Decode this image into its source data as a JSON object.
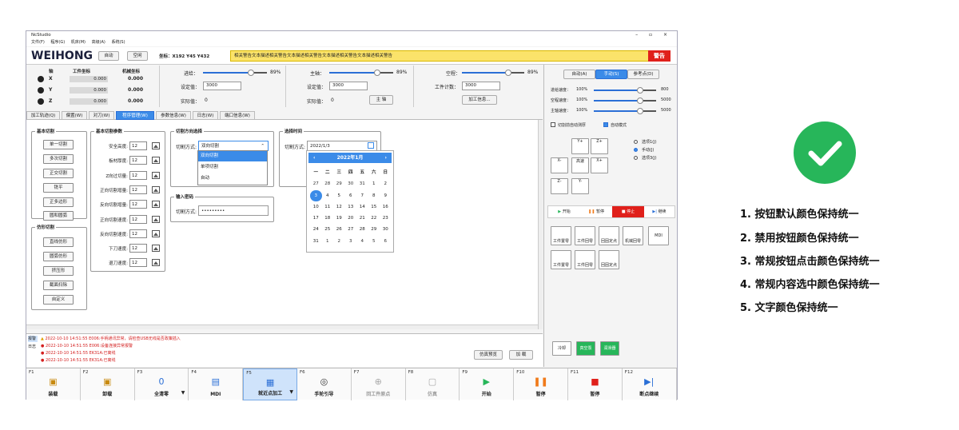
{
  "app": {
    "title": "NcStudio",
    "window_controls": "– ▫ ×",
    "menu": [
      "文件(F)",
      "程序(G)",
      "机床(M)",
      "高级(A)",
      "系统(S)"
    ]
  },
  "toprow": {
    "logo": "WEIHONG",
    "auto_btn": "自动",
    "air_btn": "空闲",
    "coords": "坐标：X192   Y45   Y432",
    "alarm_text": "相关警告文本描述相关警告文本描述相关警告文本描述相关警告文本描述相关警告",
    "alarm_btn": "警告"
  },
  "coordpanel": {
    "h_axis": "轴",
    "h_work": "工件坐标",
    "h_mach": "机械坐标",
    "rows": [
      {
        "axis": "X",
        "work": "0.000",
        "mach": "0.000"
      },
      {
        "axis": "Y",
        "work": "0.000",
        "mach": "0.000"
      },
      {
        "axis": "Z",
        "work": "0.000",
        "mach": "0.000"
      }
    ]
  },
  "feed": {
    "label": "进给：",
    "percent": "89%",
    "set_label": "设定值：",
    "set": "3000",
    "actual_label": "实际值：",
    "actual": "0"
  },
  "spindle": {
    "label": "主轴：",
    "percent": "89%",
    "set_label": "设定值：",
    "set": "3000",
    "actual_label": "实际值：",
    "actual": "0",
    "btn": "主 轴"
  },
  "rapid": {
    "label": "空程：",
    "percent": "89%",
    "count_label": "工件计数：",
    "count": "3000",
    "btn": "加工信息..."
  },
  "tabs": [
    "加工轨迹(Q)",
    "偏置(W)",
    "对刀(W)",
    "程序管理(W)",
    "参数信息(W)",
    "日志(W)",
    "端口信息(W)"
  ],
  "basic_cut": {
    "title": "基本切割",
    "buttons": [
      "单一切割",
      "多次切割",
      "正交切割",
      "铣平",
      "正多边形",
      "圆和圆弧"
    ]
  },
  "shape_cut": {
    "title": "仿形切割",
    "buttons": [
      "直线仿形",
      "圆弧仿形",
      "挤压形",
      "截面扫除",
      "自定义"
    ]
  },
  "params": {
    "title": "基本切割参数",
    "rows": [
      {
        "label": "安全高度:",
        "value": "12"
      },
      {
        "label": "板材厚度:",
        "value": "12"
      },
      {
        "label": "Z向过切量:",
        "value": "12"
      },
      {
        "label": "正向切割增量:",
        "value": "12"
      },
      {
        "label": "反向切割增量:",
        "value": "12"
      },
      {
        "label": "正向切割速度:",
        "value": "12"
      },
      {
        "label": "反向切割速度:",
        "value": "12"
      },
      {
        "label": "下刀速度:",
        "value": "12"
      },
      {
        "label": "退刀速度:",
        "value": "12"
      }
    ]
  },
  "direction": {
    "title": "切割方向选择",
    "label": "切割方式:",
    "value": "双向切割",
    "options": [
      "双向切割",
      "单项切割",
      "自动"
    ]
  },
  "password": {
    "title": "输入密码",
    "label": "切割方式:",
    "value": "•••••••••"
  },
  "time": {
    "title": "选择时间",
    "label": "切割方式:",
    "value": "2022/1/3"
  },
  "calendar": {
    "month": "2022年1月",
    "weekdays": [
      "一",
      "二",
      "三",
      "四",
      "五",
      "六",
      "日"
    ],
    "days": [
      "27",
      "28",
      "29",
      "30",
      "31",
      "1",
      "2",
      "3",
      "4",
      "5",
      "6",
      "7",
      "8",
      "9",
      "10",
      "11",
      "12",
      "13",
      "14",
      "15",
      "16",
      "17",
      "18",
      "19",
      "20",
      "21",
      "22",
      "23",
      "24",
      "25",
      "26",
      "27",
      "28",
      "29",
      "30",
      "31",
      "1",
      "2",
      "3",
      "4",
      "5",
      "6"
    ],
    "selected": "3"
  },
  "log": {
    "tag1": "报警",
    "tag2": "日志",
    "lines": [
      "2022-10-10 14:51:55  E006:手柄通讯异常，请检查USB无线是否政策插入",
      "2022-10-10 14:51:55  E006:设备连接异常报警",
      "2022-10-10 14:51:55  EK31A:已离线",
      "2022-10-10 14:51:55  EK31A:已离线"
    ],
    "sim_btn": "仿真预览",
    "load_btn": "加 载"
  },
  "right": {
    "modes": [
      "自动(A)",
      "手动(S)",
      "参考点(D)"
    ],
    "rates": [
      {
        "label": "进给速度：",
        "percent": "100%",
        "value": "800"
      },
      {
        "label": "空程速度：",
        "percent": "100%",
        "value": "5000"
      },
      {
        "label": "主轴速度：",
        "percent": "100%",
        "value": "5000"
      }
    ],
    "check1": "切割前自动测厚",
    "check2": "自动模式",
    "jog": [
      "Y+",
      "Z+",
      "X-",
      "高速",
      "X+",
      "Z-",
      "Y-"
    ],
    "radios": [
      "选项1(J)",
      "手动(J)",
      "选项3(J)"
    ],
    "runbtns": [
      "开始",
      "暂停",
      "停止",
      "继续"
    ],
    "ops": [
      "工件置零",
      "工件回零",
      "回固定点",
      "机械回零",
      "MDI",
      "工件置零",
      "工件回零",
      "回固定点"
    ],
    "io": [
      "冷却",
      "真空泵",
      "润滑器"
    ]
  },
  "fkeys": [
    {
      "fn": "F1",
      "label": "装载"
    },
    {
      "fn": "F2",
      "label": "卸载"
    },
    {
      "fn": "F3",
      "label": "全清零"
    },
    {
      "fn": "F4",
      "label": "MDI"
    },
    {
      "fn": "F5",
      "label": "就近点加工"
    },
    {
      "fn": "F6",
      "label": "手轮引导"
    },
    {
      "fn": "F7",
      "label": "回工件原点"
    },
    {
      "fn": "F8",
      "label": "仿真"
    },
    {
      "fn": "F9",
      "label": "开始"
    },
    {
      "fn": "F10",
      "label": "暂停"
    },
    {
      "fn": "F11",
      "label": "暂停"
    },
    {
      "fn": "F12",
      "label": "断点继续"
    }
  ],
  "legend": [
    "1. 按钮默认颜色保持统一",
    "2. 禁用按钮颜色保持统一",
    "3. 常规按钮点击颜色保持统一",
    "4. 常规内容选中颜色保持统一",
    "5. 文字颜色保持统一"
  ],
  "colors": {
    "accent": "#3b8be8",
    "alarm_bg": "#fbe36a",
    "alarm_btn": "#e0201b",
    "check": "#27b65a",
    "stop": "#e0201b",
    "start": "#27b65a",
    "pause": "#f07a1a"
  }
}
